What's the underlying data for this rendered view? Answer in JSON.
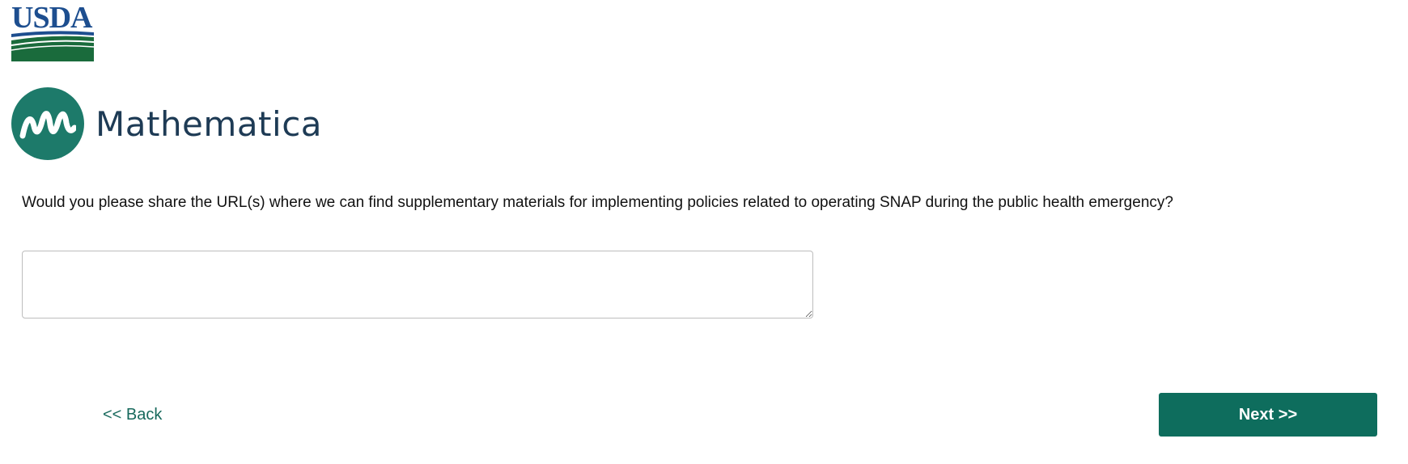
{
  "header": {
    "usda_logo_text": "USDA",
    "mathematica_logo_text": "Mathematica"
  },
  "question": {
    "text": "Would you please share the URL(s) where we can find supplementary materials for implementing policies related to operating SNAP during the public health emergency?"
  },
  "answer": {
    "value": "",
    "placeholder": ""
  },
  "nav": {
    "back_label": "<< Back",
    "next_label": "Next >>"
  },
  "colors": {
    "usda_blue": "#1d4e8f",
    "usda_green": "#1a6b3c",
    "mathematica_teal": "#1d7a6a",
    "mathematica_navy": "#1e3b55",
    "button_green": "#0e6d5d",
    "link_green": "#17695c"
  },
  "icons": {
    "usda_logo": "usda-logo",
    "mathematica_logo": "mathematica-m-icon",
    "resize_handle": "resize-grip-icon"
  }
}
